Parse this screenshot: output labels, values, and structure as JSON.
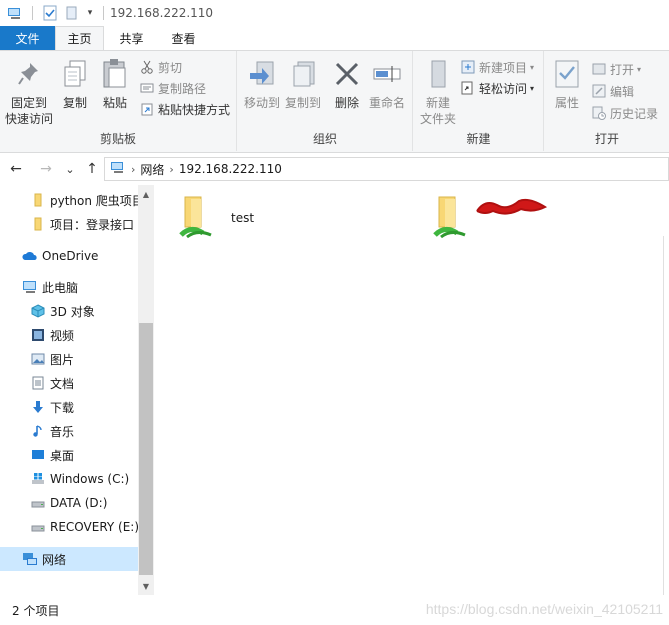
{
  "window": {
    "title": "192.168.222.110",
    "quick_access_icons": [
      "explorer-icon",
      "properties-check-icon",
      "new-folder-icon",
      "customize-dropdown-icon"
    ]
  },
  "tabs": [
    {
      "label": "文件",
      "active": false
    },
    {
      "label": "主页",
      "active": true
    },
    {
      "label": "共享",
      "active": false
    },
    {
      "label": "查看",
      "active": false
    }
  ],
  "ribbon": {
    "clipboard": {
      "label": "剪贴板",
      "pin_line1": "固定到",
      "pin_line2": "快速访问",
      "copy": "复制",
      "paste": "粘贴",
      "cut": "剪切",
      "copy_path": "复制路径",
      "paste_shortcut": "粘贴快捷方式"
    },
    "organize": {
      "label": "组织",
      "move_to": "移动到",
      "copy_to": "复制到",
      "delete": "删除",
      "rename": "重命名"
    },
    "new": {
      "label": "新建",
      "new_folder_line1": "新建",
      "new_folder_line2": "文件夹",
      "new_item": "新建项目",
      "easy_access": "轻松访问"
    },
    "open": {
      "label": "打开",
      "properties": "属性",
      "open": "打开",
      "edit": "编辑",
      "history": "历史记录"
    }
  },
  "address": {
    "back": "←",
    "forward": "→",
    "recent": "⌄",
    "up": "↑",
    "path": [
      "网络",
      "192.168.222.110"
    ]
  },
  "sidebar": {
    "items": [
      {
        "label": "python 爬虫项目",
        "icon": "folder-icon"
      },
      {
        "label": "项目：登录接口",
        "icon": "folder-icon"
      },
      {
        "label": "OneDrive",
        "icon": "onedrive-icon"
      },
      {
        "label": "此电脑",
        "icon": "this-pc-icon"
      },
      {
        "label": "3D 对象",
        "icon": "3d-objects-icon"
      },
      {
        "label": "视频",
        "icon": "videos-icon"
      },
      {
        "label": "图片",
        "icon": "pictures-icon"
      },
      {
        "label": "文档",
        "icon": "documents-icon"
      },
      {
        "label": "下载",
        "icon": "downloads-icon"
      },
      {
        "label": "音乐",
        "icon": "music-icon"
      },
      {
        "label": "桌面",
        "icon": "desktop-icon"
      },
      {
        "label": "Windows (C:)",
        "icon": "windows-drive-icon"
      },
      {
        "label": "DATA (D:)",
        "icon": "drive-icon"
      },
      {
        "label": "RECOVERY (E:)",
        "icon": "drive-icon"
      },
      {
        "label": "网络",
        "icon": "network-icon",
        "selected": true
      }
    ]
  },
  "content": {
    "items": [
      {
        "name": "test",
        "icon": "network-share-folder-icon"
      },
      {
        "name": "",
        "icon": "network-share-folder-icon",
        "label_redacted": true
      }
    ]
  },
  "status": {
    "count": "2 个项目"
  },
  "watermark": "https://blog.csdn.net/weixin_42105211",
  "colors": {
    "file_tab": "#1979ca",
    "ribbon_bg": "#f5f6f7",
    "selection": "#cce8ff",
    "folder_yellow": "#f8d775",
    "share_green": "#3fb63f",
    "redaction_red": "#d01818"
  }
}
